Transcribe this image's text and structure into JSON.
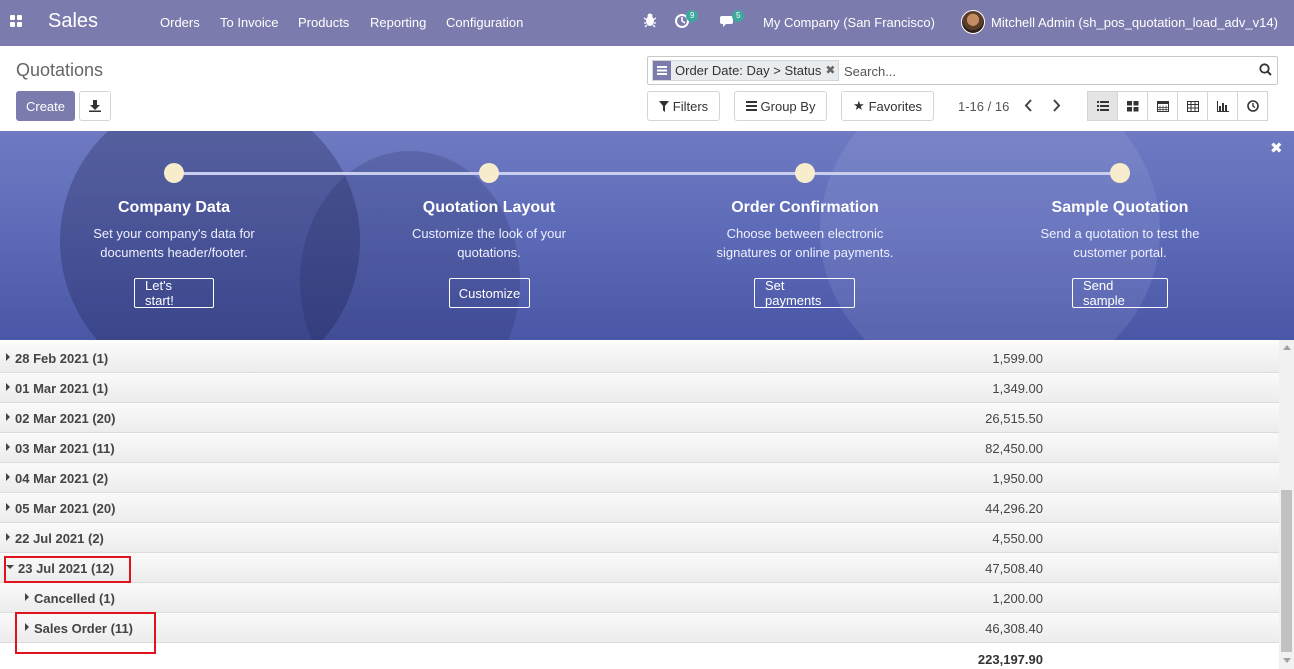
{
  "navbar": {
    "brand": "Sales",
    "menu": [
      "Orders",
      "To Invoice",
      "Products",
      "Reporting",
      "Configuration"
    ],
    "activity_count": "9",
    "message_count": "5",
    "company": "My Company (San Francisco)",
    "user": "Mitchell Admin (sh_pos_quotation_load_adv_v14)"
  },
  "control": {
    "title": "Quotations",
    "create_label": "Create",
    "facet_label": "Order Date: Day > Status",
    "search_placeholder": "Search...",
    "filters_label": "Filters",
    "groupby_label": "Group By",
    "favorites_label": "Favorites",
    "pager": "1-16 / 16"
  },
  "banner": {
    "steps": [
      {
        "title": "Company Data",
        "line1": "Set your company's data for",
        "line2": "documents header/footer.",
        "button": "Let's start!"
      },
      {
        "title": "Quotation Layout",
        "line1": "Customize the look of your",
        "line2": "quotations.",
        "button": "Customize"
      },
      {
        "title": "Order Confirmation",
        "line1": "Choose between electronic",
        "line2": "signatures or online payments.",
        "button": "Set payments"
      },
      {
        "title": "Sample Quotation",
        "line1": "Send a quotation to test the",
        "line2": "customer portal.",
        "button": "Send sample"
      }
    ]
  },
  "groups": [
    {
      "label": "28 Feb 2021 (1)",
      "amount": "1,599.00",
      "level": 0,
      "open": false
    },
    {
      "label": "01 Mar 2021 (1)",
      "amount": "1,349.00",
      "level": 0,
      "open": false
    },
    {
      "label": "02 Mar 2021 (20)",
      "amount": "26,515.50",
      "level": 0,
      "open": false
    },
    {
      "label": "03 Mar 2021 (11)",
      "amount": "82,450.00",
      "level": 0,
      "open": false
    },
    {
      "label": "04 Mar 2021 (2)",
      "amount": "1,950.00",
      "level": 0,
      "open": false
    },
    {
      "label": "05 Mar 2021 (20)",
      "amount": "44,296.20",
      "level": 0,
      "open": false
    },
    {
      "label": "22 Jul 2021 (2)",
      "amount": "4,550.00",
      "level": 0,
      "open": false
    },
    {
      "label": "23 Jul 2021 (12)",
      "amount": "47,508.40",
      "level": 0,
      "open": true
    },
    {
      "label": "Cancelled (1)",
      "amount": "1,200.00",
      "level": 1,
      "open": false
    },
    {
      "label": "Sales Order (11)",
      "amount": "46,308.40",
      "level": 1,
      "open": false
    }
  ],
  "total": "223,197.90",
  "colors": {
    "primary": "#7c7bad",
    "highlight": "#e0141e"
  }
}
